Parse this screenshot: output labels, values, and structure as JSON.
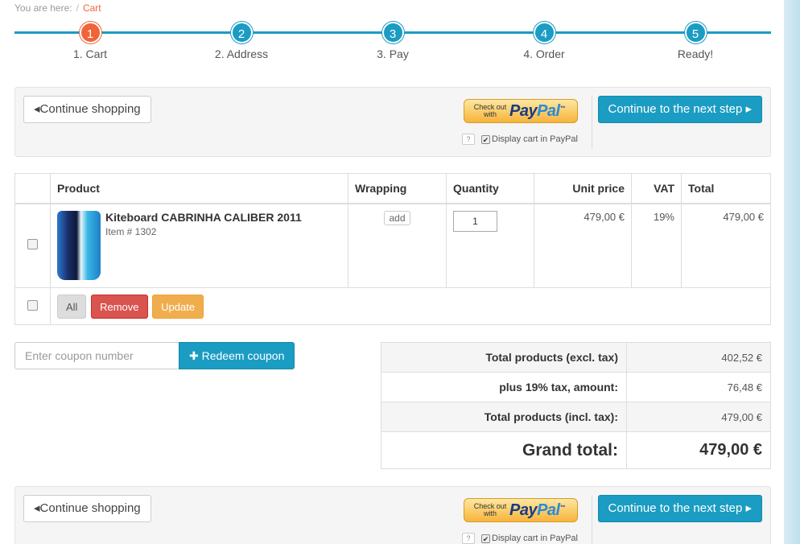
{
  "breadcrumb": {
    "prefix": "You are here:",
    "sep": "/",
    "current": "Cart"
  },
  "steps": [
    {
      "num": "1",
      "label": "1. Cart",
      "active": true
    },
    {
      "num": "2",
      "label": "2. Address"
    },
    {
      "num": "3",
      "label": "3. Pay"
    },
    {
      "num": "4",
      "label": "4. Order"
    },
    {
      "num": "5",
      "label": "Ready!"
    }
  ],
  "actions": {
    "continue_shopping": "Continue shopping",
    "next_step": "Continue to the next step",
    "paypal_small_1": "Check out",
    "paypal_small_2": "with",
    "paypal_word_1": "Pay",
    "paypal_word_2": "Pal",
    "paypal_tm": "™",
    "help": "?",
    "display_in_paypal": "Display cart in PayPal"
  },
  "cart": {
    "headers": {
      "product": "Product",
      "wrapping": "Wrapping",
      "quantity": "Quantity",
      "unit_price": "Unit price",
      "vat": "VAT",
      "total": "Total"
    },
    "items": [
      {
        "name": "Kiteboard CABRINHA CALIBER 2011",
        "item_no": "Item # 1302",
        "wrapping_btn": "add",
        "quantity": "1",
        "unit_price": "479,00 €",
        "vat": "19%",
        "total": "479,00 €"
      }
    ],
    "bulk": {
      "all": "All",
      "remove": "Remove",
      "update": "Update"
    }
  },
  "coupon": {
    "placeholder": "Enter coupon number",
    "button": "Redeem coupon"
  },
  "totals": {
    "excl_label": "Total products (excl. tax)",
    "excl_value": "402,52 €",
    "tax_label": "plus 19% tax, amount:",
    "tax_value": "76,48 €",
    "incl_label": "Total products (incl. tax):",
    "incl_value": "479,00 €",
    "grand_label": "Grand total:",
    "grand_value": "479,00 €"
  },
  "colors": {
    "accent": "#1a9cc3",
    "active_step": "#f0643a",
    "remove": "#d9534f",
    "update": "#f0ad4e"
  }
}
